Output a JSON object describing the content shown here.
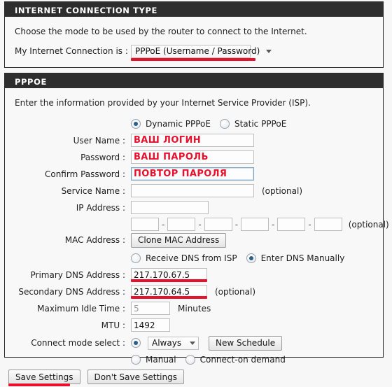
{
  "sections": {
    "connection_type": {
      "title": "INTERNET CONNECTION TYPE",
      "intro": "Choose the mode to be used by the router to connect to the Internet.",
      "connection_label": "My Internet Connection is :",
      "connection_value": "PPPoE (Username / Password)"
    },
    "pppoe": {
      "title": "PPPOE",
      "intro": "Enter the information provided by your Internet Service Provider (ISP).",
      "mode_dynamic": "Dynamic PPPoE",
      "mode_static": "Static PPPoE",
      "labels": {
        "user_name": "User Name :",
        "password": "Password :",
        "confirm_password": "Confirm Password :",
        "service_name": "Service Name :",
        "ip_address": "IP Address :",
        "mac_address": "MAC Address :",
        "primary_dns": "Primary DNS Address :",
        "secondary_dns": "Secondary DNS Address :",
        "max_idle": "Maximum Idle Time :",
        "mtu": "MTU :",
        "connect_mode": "Connect mode select :"
      },
      "values": {
        "user_name": "ВАШ ЛОГИН",
        "password": "ВАШ ПАРОЛЬ",
        "confirm_password": "ПОВТОР ПАРОЛЯ",
        "service_name": "",
        "ip_address": "",
        "mac1": "",
        "mac2": "",
        "mac3": "",
        "mac4": "",
        "mac5": "",
        "mac6": "",
        "primary_dns": "217.170.67.5",
        "secondary_dns": "217.170.64.5",
        "max_idle": "5",
        "mtu": "1492",
        "connect_mode": "Always"
      },
      "optional_text": "(optional)",
      "clone_mac_button": "Clone MAC Address",
      "dns_from_isp": "Receive DNS from ISP",
      "dns_manual": "Enter DNS Manually",
      "minutes": "Minutes",
      "new_schedule_button": "New Schedule",
      "mode_manual": "Manual",
      "mode_on_demand": "Connect-on demand"
    }
  },
  "footer": {
    "save": "Save Settings",
    "dont_save": "Don't Save Settings"
  },
  "colors": {
    "header_bg": "#2e2e2e",
    "highlight": "#e8112d",
    "panel_bg": "#f8f8f8"
  }
}
